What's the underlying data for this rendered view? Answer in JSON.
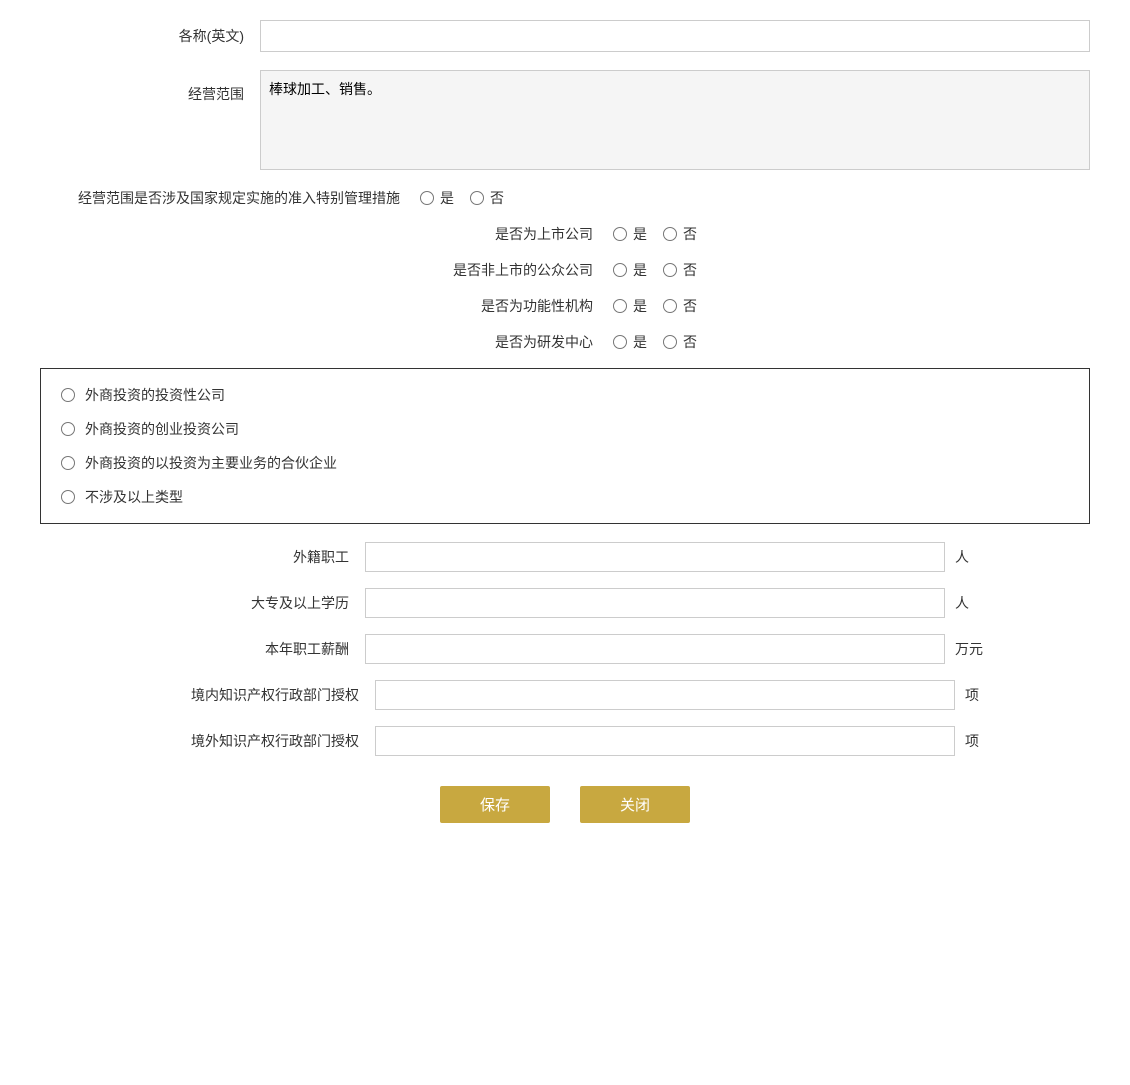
{
  "form": {
    "name_english_label": "各称(英文)",
    "name_english_value": "",
    "business_scope_label": "经营范围",
    "business_scope_value": "棒球加工、销售。",
    "special_management_label": "经营范围是否涉及国家规定实施的准入特别管理措施",
    "special_management_yes": "是",
    "special_management_no": "否",
    "listed_company_label": "是否为上市公司",
    "listed_company_yes": "是",
    "listed_company_no": "否",
    "non_listed_public_label": "是否非上市的公众公司",
    "non_listed_public_yes": "是",
    "non_listed_public_no": "否",
    "functional_institution_label": "是否为功能性机构",
    "functional_institution_yes": "是",
    "functional_institution_no": "否",
    "rd_center_label": "是否为研发中心",
    "rd_center_yes": "是",
    "rd_center_no": "否",
    "investment_company_option": "外商投资的投资性公司",
    "venture_company_option": "外商投资的创业投资公司",
    "partnership_option": "外商投资的以投资为主要业务的合伙企业",
    "not_involved_option": "不涉及以上类型",
    "foreign_employees_label": "外籍职工",
    "foreign_employees_value": "",
    "foreign_employees_unit": "人",
    "college_above_label": "大专及以上学历",
    "college_above_value": "",
    "college_above_unit": "人",
    "annual_salary_label": "本年职工薪酬",
    "annual_salary_value": "",
    "annual_salary_unit": "万元",
    "domestic_ip_label": "境内知识产权行政部门授权",
    "domestic_ip_value": "",
    "domestic_ip_unit": "项",
    "foreign_ip_label": "境外知识产权行政部门授权",
    "foreign_ip_value": "",
    "foreign_ip_unit": "项",
    "save_button": "保存",
    "close_button": "关闭"
  }
}
